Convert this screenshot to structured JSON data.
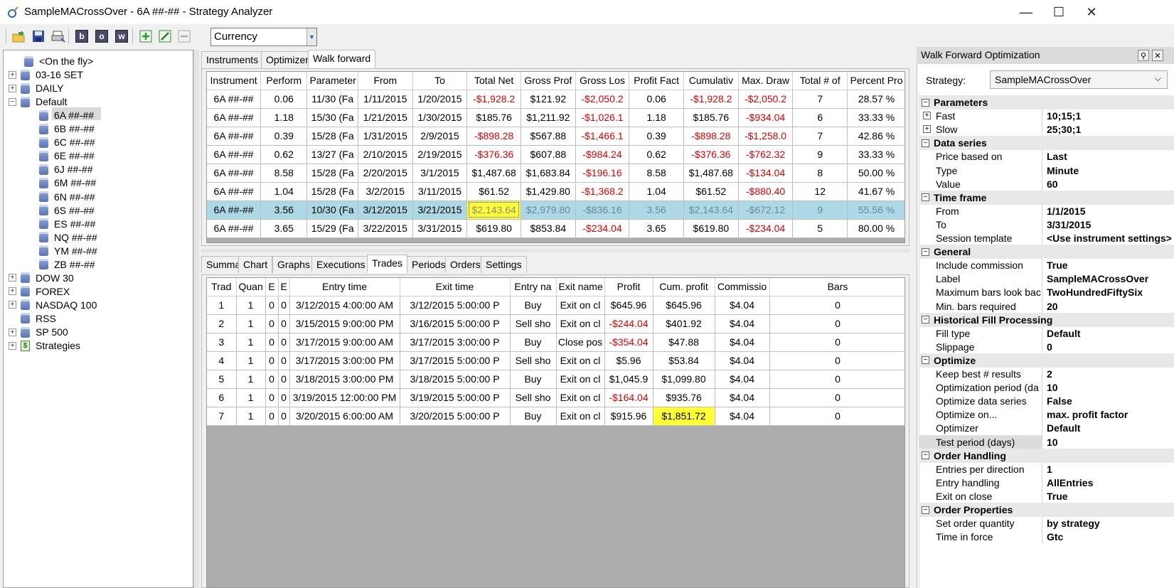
{
  "window": {
    "title": "SampleMACrossOver - 6A ##-## - Strategy Analyzer",
    "minimize": "—",
    "maximize": "☐",
    "close": "✕"
  },
  "toolbar": {
    "buttons": [
      "open-icon",
      "save-icon",
      "print-icon",
      "b",
      "o",
      "w",
      "add-icon",
      "edit-icon",
      "remove-icon"
    ],
    "currency": "Currency"
  },
  "tree": [
    {
      "label": "<On the fly>",
      "indent": 1,
      "expander": "",
      "icon": "db"
    },
    {
      "label": "03-16 SET",
      "indent": 0,
      "expander": "+",
      "icon": "db"
    },
    {
      "label": "DAILY",
      "indent": 0,
      "expander": "+",
      "icon": "db"
    },
    {
      "label": "Default",
      "indent": 0,
      "expander": "−",
      "icon": "db"
    },
    {
      "label": "6A ##-##",
      "indent": 2,
      "expander": "",
      "icon": "db",
      "selected": true
    },
    {
      "label": "6B ##-##",
      "indent": 2,
      "expander": "",
      "icon": "db"
    },
    {
      "label": "6C ##-##",
      "indent": 2,
      "expander": "",
      "icon": "db"
    },
    {
      "label": "6E ##-##",
      "indent": 2,
      "expander": "",
      "icon": "db"
    },
    {
      "label": "6J ##-##",
      "indent": 2,
      "expander": "",
      "icon": "db"
    },
    {
      "label": "6M ##-##",
      "indent": 2,
      "expander": "",
      "icon": "db"
    },
    {
      "label": "6N ##-##",
      "indent": 2,
      "expander": "",
      "icon": "db"
    },
    {
      "label": "6S ##-##",
      "indent": 2,
      "expander": "",
      "icon": "db"
    },
    {
      "label": "ES ##-##",
      "indent": 2,
      "expander": "",
      "icon": "db"
    },
    {
      "label": "NQ ##-##",
      "indent": 2,
      "expander": "",
      "icon": "db"
    },
    {
      "label": "YM ##-##",
      "indent": 2,
      "expander": "",
      "icon": "db"
    },
    {
      "label": "ZB ##-##",
      "indent": 2,
      "expander": "",
      "icon": "db"
    },
    {
      "label": "DOW 30",
      "indent": 0,
      "expander": "+",
      "icon": "db"
    },
    {
      "label": "FOREX",
      "indent": 0,
      "expander": "+",
      "icon": "db"
    },
    {
      "label": "NASDAQ 100",
      "indent": 0,
      "expander": "+",
      "icon": "db"
    },
    {
      "label": "RSS",
      "indent": 0,
      "expander": "",
      "icon": "db"
    },
    {
      "label": "SP 500",
      "indent": 0,
      "expander": "+",
      "icon": "db"
    },
    {
      "label": "Strategies",
      "indent": 0,
      "expander": "+",
      "icon": "strategy"
    }
  ],
  "upper_tabs": [
    "Instruments",
    "Optimizer",
    "Walk forward"
  ],
  "wf_table": {
    "headers": [
      "Instrument",
      "Perform",
      "Parameter",
      "From",
      "To",
      "Total Net",
      "Gross Prof",
      "Gross Los",
      "Profit Fact",
      "Cumulativ",
      "Max. Draw",
      "Total # of",
      "Percent Pro"
    ],
    "rows": [
      [
        "6A ##-##",
        "0.06",
        "11/30 (Fa",
        "1/11/2015",
        "1/20/2015",
        "-$1,928.2",
        "$121.92",
        "-$2,050.2",
        "0.06",
        "-$1,928.2",
        "-$2,050.2",
        "7",
        "28.57 %"
      ],
      [
        "6A ##-##",
        "1.18",
        "15/30 (Fa",
        "1/21/2015",
        "1/30/2015",
        "$185.76",
        "$1,211.92",
        "-$1,026.1",
        "1.18",
        "$185.76",
        "-$934.04",
        "6",
        "33.33 %"
      ],
      [
        "6A ##-##",
        "0.39",
        "15/28 (Fa",
        "1/31/2015",
        "2/9/2015",
        "-$898.28",
        "$567.88",
        "-$1,466.1",
        "0.39",
        "-$898.28",
        "-$1,258.0",
        "7",
        "42.86 %"
      ],
      [
        "6A ##-##",
        "0.62",
        "13/27 (Fa",
        "2/10/2015",
        "2/19/2015",
        "-$376.36",
        "$607.88",
        "-$984.24",
        "0.62",
        "-$376.36",
        "-$762.32",
        "9",
        "33.33 %"
      ],
      [
        "6A ##-##",
        "8.58",
        "15/28 (Fa",
        "2/20/2015",
        "3/1/2015",
        "$1,487.68",
        "$1,683.84",
        "-$196.16",
        "8.58",
        "$1,487.68",
        "-$134.04",
        "8",
        "50.00 %"
      ],
      [
        "6A ##-##",
        "1.04",
        "15/28 (Fa",
        "3/2/2015",
        "3/11/2015",
        "$61.52",
        "$1,429.80",
        "-$1,368.2",
        "1.04",
        "$61.52",
        "-$880.40",
        "12",
        "41.67 %"
      ],
      [
        "6A ##-##",
        "3.56",
        "10/30 (Fa",
        "3/12/2015",
        "3/21/2015",
        "$2,143.64",
        "$2,979.80",
        "-$836.16",
        "3.56",
        "$2,143.64",
        "-$672.12",
        "9",
        "55.56 %"
      ],
      [
        "6A ##-##",
        "3.65",
        "15/29 (Fa",
        "3/22/2015",
        "3/31/2015",
        "$619.80",
        "$853.84",
        "-$234.04",
        "3.65",
        "$619.80",
        "-$234.04",
        "5",
        "80.00 %"
      ]
    ],
    "selected_row": 6,
    "highlight_color": "#ffff33",
    "selection_color": "#add8e6",
    "negative_color": "#e00000"
  },
  "lower_tabs": [
    "Summary",
    "Chart",
    "Graphs",
    "Executions",
    "Trades",
    "Periods",
    "Orders",
    "Settings"
  ],
  "trades_table": {
    "headers": [
      "Trad",
      "Quan",
      "E",
      "E",
      "Entry time",
      "Exit time",
      "Entry na",
      "Exit name",
      "Profit",
      "Cum. profit",
      "Commissio",
      "Bars"
    ],
    "rows": [
      [
        "1",
        "1",
        "0",
        "0",
        "3/12/2015 4:00:00 AM",
        "3/12/2015 5:00:00 P",
        "Buy",
        "Exit on cl",
        "$645.96",
        "$645.96",
        "$4.04",
        "0"
      ],
      [
        "2",
        "1",
        "0",
        "0",
        "3/15/2015 9:00:00 PM",
        "3/16/2015 5:00:00 P",
        "Sell sho",
        "Exit on cl",
        "-$244.04",
        "$401.92",
        "$4.04",
        "0"
      ],
      [
        "3",
        "1",
        "0",
        "0",
        "3/17/2015 9:00:00 AM",
        "3/17/2015 3:00:00 P",
        "Buy",
        "Close pos",
        "-$354.04",
        "$47.88",
        "$4.04",
        "0"
      ],
      [
        "4",
        "1",
        "0",
        "0",
        "3/17/2015 3:00:00 PM",
        "3/17/2015 5:00:00 P",
        "Sell sho",
        "Exit on cl",
        "$5.96",
        "$53.84",
        "$4.04",
        "0"
      ],
      [
        "5",
        "1",
        "0",
        "0",
        "3/18/2015 3:00:00 PM",
        "3/18/2015 5:00:00 P",
        "Buy",
        "Exit on cl",
        "$1,045.9",
        "$1,099.80",
        "$4.04",
        "0"
      ],
      [
        "6",
        "1",
        "0",
        "0",
        "3/19/2015 12:00:00 PM",
        "3/19/2015 5:00:00 P",
        "Sell sho",
        "Exit on cl",
        "-$164.04",
        "$935.76",
        "$4.04",
        "0"
      ],
      [
        "7",
        "1",
        "0",
        "0",
        "3/20/2015 6:00:00 AM",
        "3/20/2015 5:00:00 P",
        "Buy",
        "Exit on cl",
        "$915.96",
        "$1,851.72",
        "$4.04",
        "0"
      ]
    ]
  },
  "right_panel": {
    "title": "Walk Forward Optimization",
    "strategy_label": "Strategy:",
    "strategy_value": "SampleMACrossOver",
    "grid": [
      {
        "type": "cat",
        "label": "Parameters"
      },
      {
        "type": "row",
        "name": "Fast",
        "value": "10;15;1",
        "expandable": true
      },
      {
        "type": "row",
        "name": "Slow",
        "value": "25;30;1",
        "expandable": true
      },
      {
        "type": "cat",
        "label": "Data series"
      },
      {
        "type": "row",
        "name": "Price based on",
        "value": "Last"
      },
      {
        "type": "row",
        "name": "Type",
        "value": "Minute"
      },
      {
        "type": "row",
        "name": "Value",
        "value": "60"
      },
      {
        "type": "cat",
        "label": "Time frame"
      },
      {
        "type": "row",
        "name": "From",
        "value": "1/1/2015"
      },
      {
        "type": "row",
        "name": "To",
        "value": "3/31/2015"
      },
      {
        "type": "row",
        "name": "Session template",
        "value": "<Use instrument settings>"
      },
      {
        "type": "cat",
        "label": "General"
      },
      {
        "type": "row",
        "name": "Include commission",
        "value": "True"
      },
      {
        "type": "row",
        "name": "Label",
        "value": "SampleMACrossOver"
      },
      {
        "type": "row",
        "name": "Maximum bars look bac",
        "value": "TwoHundredFiftySix"
      },
      {
        "type": "row",
        "name": "Min. bars required",
        "value": "20"
      },
      {
        "type": "cat",
        "label": "Historical Fill Processing"
      },
      {
        "type": "row",
        "name": "Fill type",
        "value": "Default"
      },
      {
        "type": "row",
        "name": "Slippage",
        "value": "0"
      },
      {
        "type": "cat",
        "label": "Optimize"
      },
      {
        "type": "row",
        "name": "Keep best # results",
        "value": "2"
      },
      {
        "type": "row",
        "name": "Optimization period (da",
        "value": "10"
      },
      {
        "type": "row",
        "name": "Optimize data series",
        "value": "False"
      },
      {
        "type": "row",
        "name": "Optimize on...",
        "value": "max. profit factor"
      },
      {
        "type": "row",
        "name": "Optimizer",
        "value": "Default"
      },
      {
        "type": "row",
        "name": "Test period (days)",
        "value": "10",
        "selected": true
      },
      {
        "type": "cat",
        "label": "Order Handling"
      },
      {
        "type": "row",
        "name": "Entries per direction",
        "value": "1"
      },
      {
        "type": "row",
        "name": "Entry handling",
        "value": "AllEntries"
      },
      {
        "type": "row",
        "name": "Exit on close",
        "value": "True"
      },
      {
        "type": "cat",
        "label": "Order Properties"
      },
      {
        "type": "row",
        "name": "Set order quantity",
        "value": "by strategy"
      },
      {
        "type": "row",
        "name": "Time in force",
        "value": "Gtc"
      }
    ]
  }
}
